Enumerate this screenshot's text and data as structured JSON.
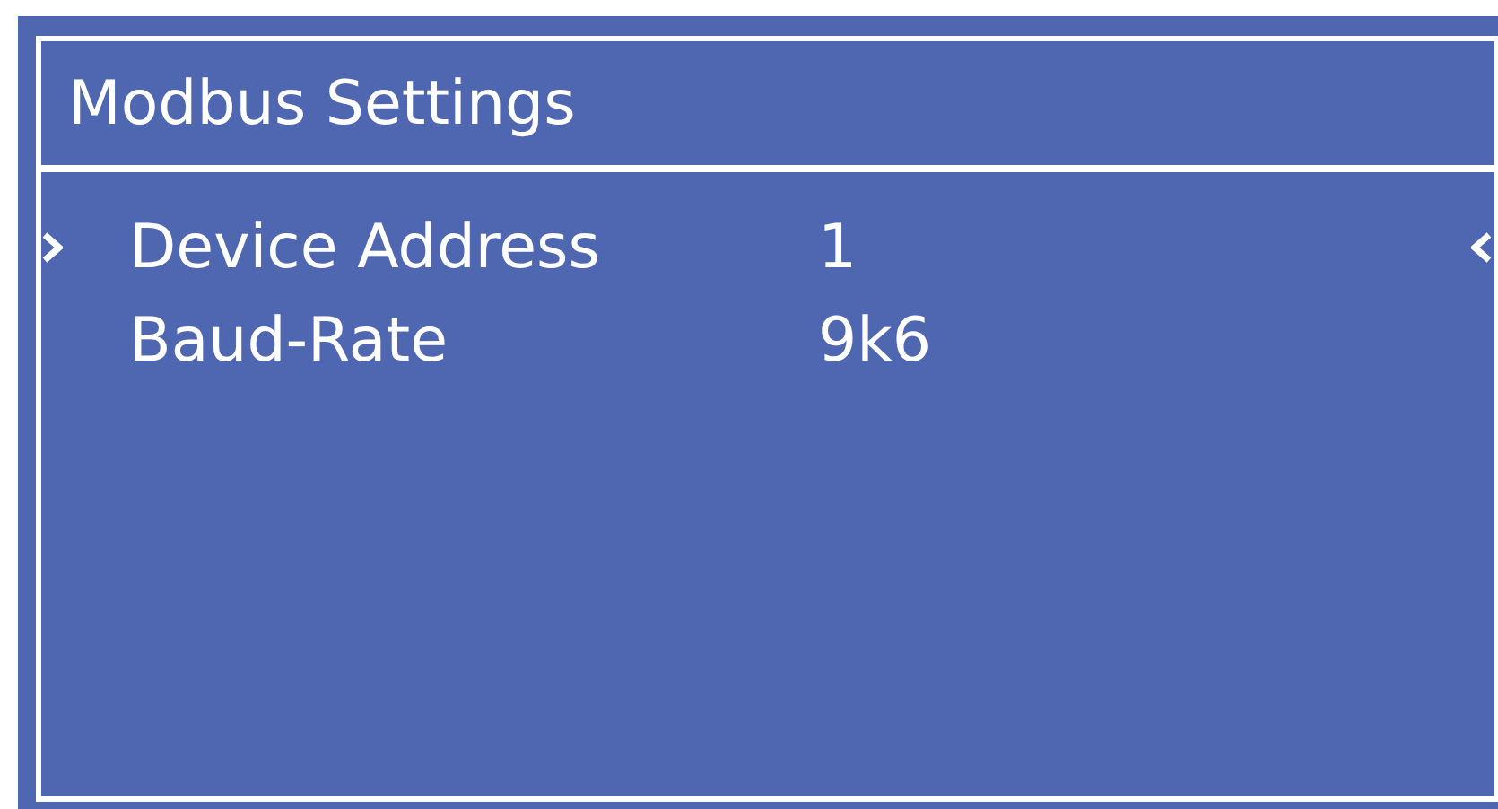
{
  "title": "Modbus Settings",
  "items": [
    {
      "label": "Device Address",
      "value": "1",
      "selected": true
    },
    {
      "label": "Baud-Rate",
      "value": "9k6",
      "selected": false
    }
  ]
}
